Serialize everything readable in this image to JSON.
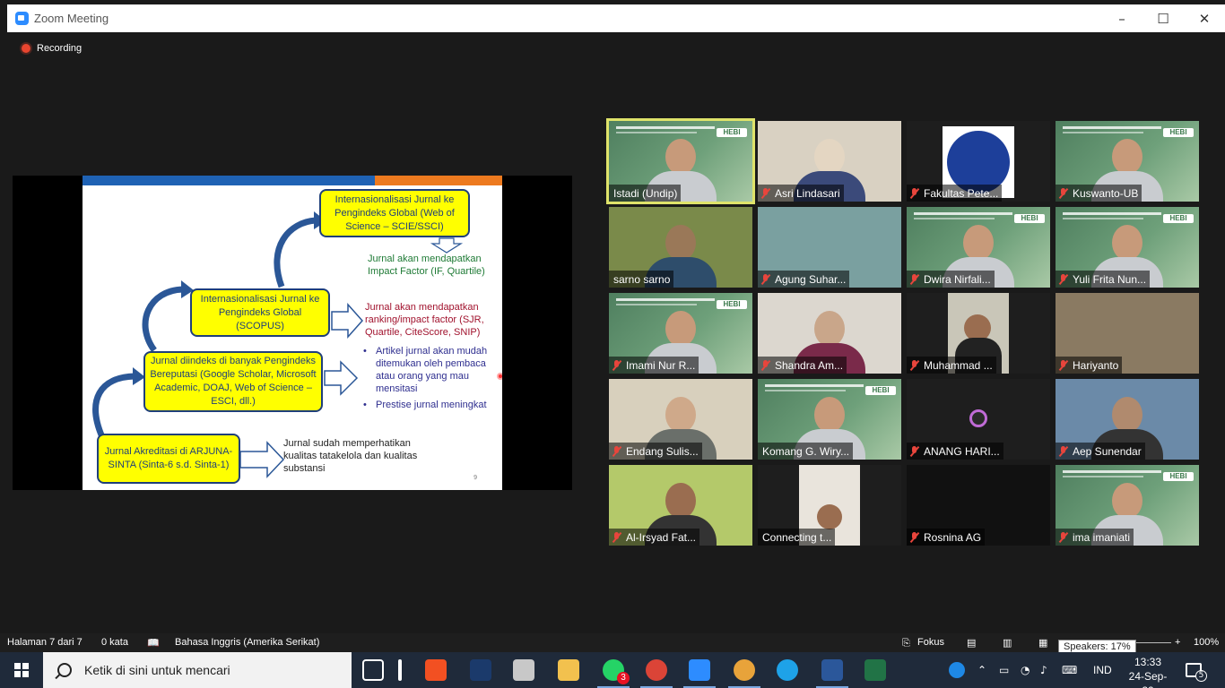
{
  "window": {
    "title": "Zoom Meeting",
    "minimize": "–",
    "maximize": "☐",
    "close": "✕"
  },
  "recording": {
    "label": "Recording"
  },
  "slide": {
    "box_global_ssci": "Internasionalisasi Jurnal ke Pengindeks Global (Web of Science – SCIE/SSCI)",
    "impact_factor_line1": "Jurnal akan mendapatkan",
    "impact_factor_line2": "Impact Factor (IF, Quartile)",
    "box_scopus": "Internasionalisasi Jurnal ke Pengindeks Global (SCOPUS)",
    "ranking_line1": "Jurnal akan mendapatkan",
    "ranking_line2": "ranking/impact factor (SJR,",
    "ranking_line3": "Quartile, CiteScore, SNIP)",
    "box_reputable": "Jurnal diindeks di banyak Pengindeks Bereputasi (Google Scholar, Microsoft Academic, DOAJ, Web of Science – ESCI, dll.)",
    "bullet1": "Artikel jurnal akan mudah ditemukan oleh pembaca atau orang yang mau mensitasi",
    "bullet2": "Prestise jurnal meningkat",
    "box_sinta": "Jurnal Akreditasi di ARJUNA-SINTA (Sinta-6 s.d. Sinta-1)",
    "sinta_note": "Jurnal sudah memperhatikan kualitas tatakelola dan kualitas substansi",
    "page_number": "9",
    "colors": {
      "bar_blue": "#1f62b4",
      "bar_orange": "#ed7a1f",
      "box_yellow": "#ffff00"
    }
  },
  "participants": [
    {
      "name": "Istadi (Undip)",
      "muted": false
    },
    {
      "name": "Asri Lindasari",
      "muted": true
    },
    {
      "name": "Fakultas Pete...",
      "muted": true
    },
    {
      "name": "Kuswanto-UB",
      "muted": true
    },
    {
      "name": "sarno sarno",
      "muted": false
    },
    {
      "name": "Agung Suhar...",
      "muted": true
    },
    {
      "name": "Dwira Nirfali...",
      "muted": true
    },
    {
      "name": "Yuli Frita Nun...",
      "muted": true
    },
    {
      "name": "Imami Nur R...",
      "muted": true
    },
    {
      "name": "Shandra Am...",
      "muted": true
    },
    {
      "name": "Muhammad ...",
      "muted": true
    },
    {
      "name": "Hariyanto",
      "muted": true
    },
    {
      "name": "Endang Sulis...",
      "muted": true
    },
    {
      "name": "Komang G. Wiry...",
      "muted": false
    },
    {
      "name": "ANANG HARI...",
      "muted": true
    },
    {
      "name": "Aep Sunendar",
      "muted": true
    },
    {
      "name": "Al-Irsyad Fat...",
      "muted": true
    },
    {
      "name": "Connecting t...",
      "muted": false
    },
    {
      "name": "Rosnina AG",
      "muted": true
    },
    {
      "name": "ima imaniati",
      "muted": true
    }
  ],
  "hebi_logo": "HEBI",
  "statusbar": {
    "page": "Halaman 7 dari 7",
    "words": "0 kata",
    "language": "Bahasa Inggris (Amerika Serikat)",
    "focus": "Fokus",
    "zoom_minus": "–",
    "zoom_plus": "+",
    "zoom": "100%"
  },
  "tooltip": "Speakers: 17%",
  "taskbar": {
    "search_placeholder": "Ketik di sini untuk mencari",
    "whatsapp_badge": "3",
    "language": "IND",
    "time": "13:33",
    "date": "24-Sep-20",
    "notifications": "5"
  }
}
